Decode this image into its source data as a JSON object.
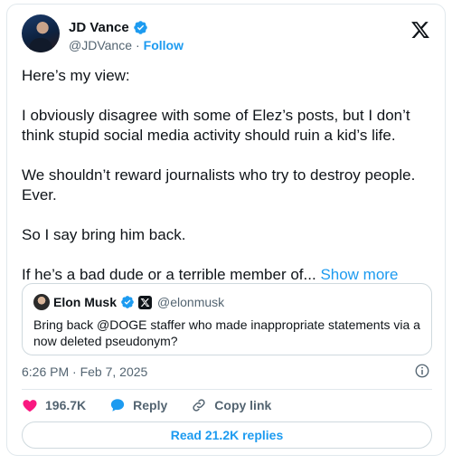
{
  "author": {
    "display_name": "JD Vance",
    "handle": "@JDVance",
    "separator": "·",
    "follow_label": "Follow"
  },
  "post": {
    "paragraphs": [
      "Here’s my view:",
      "I obviously disagree with some of Elez’s posts, but I don’t think stupid social media activity should ruin a kid’s life.",
      "We shouldn’t reward journalists who try to destroy people. Ever.",
      "So I say bring him back."
    ],
    "truncated": "If he’s a bad dude or a terrible member of...",
    "show_more_label": "Show more"
  },
  "quoted": {
    "display_name": "Elon Musk",
    "handle": "@elonmusk",
    "text": "Bring back @DOGE staffer who made inappropriate statements via a now deleted pseudonym?"
  },
  "timestamp": "6:26 PM · Feb 7, 2025",
  "actions": {
    "likes": "196.7K",
    "reply_label": "Reply",
    "copy_link_label": "Copy link"
  },
  "read_replies_label": "Read 21.2K replies",
  "colors": {
    "accent": "#1d9bf0",
    "like": "#f91880",
    "text": "#0f1419",
    "secondary": "#536471"
  }
}
